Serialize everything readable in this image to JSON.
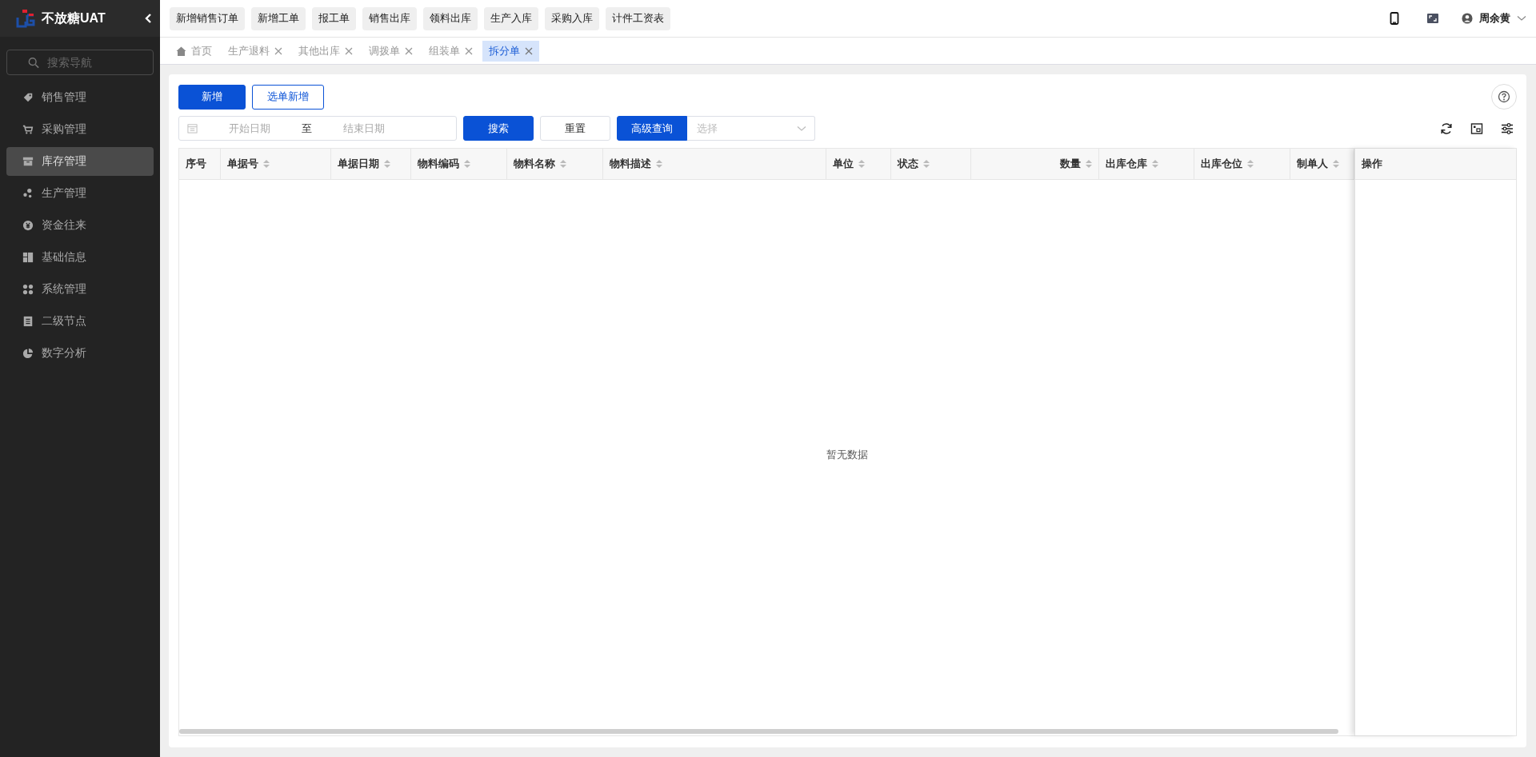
{
  "sidebar": {
    "brand": "不放糖UAT",
    "search": {
      "placeholder": "搜索导航"
    },
    "items": [
      {
        "label": "销售管理",
        "selected": false
      },
      {
        "label": "采购管理",
        "selected": false
      },
      {
        "label": "库存管理",
        "selected": true
      },
      {
        "label": "生产管理",
        "selected": false
      },
      {
        "label": "资金往来",
        "selected": false
      },
      {
        "label": "基础信息",
        "selected": false
      },
      {
        "label": "系统管理",
        "selected": false
      },
      {
        "label": "二级节点",
        "selected": false
      },
      {
        "label": "数字分析",
        "selected": false
      }
    ]
  },
  "shortcuts": [
    "新增销售订单",
    "新增工单",
    "报工单",
    "销售出库",
    "领料出库",
    "生产入库",
    "采购入库",
    "计件工资表"
  ],
  "user": {
    "name": "周余黄"
  },
  "tabs": [
    {
      "label": "首页",
      "kind": "home",
      "selected": false
    },
    {
      "label": "生产退料",
      "kind": "closable",
      "selected": false
    },
    {
      "label": "其他出库",
      "kind": "closable",
      "selected": false
    },
    {
      "label": "调拨单",
      "kind": "closable",
      "selected": false
    },
    {
      "label": "组装单",
      "kind": "closable",
      "selected": false
    },
    {
      "label": "拆分单",
      "kind": "closable",
      "selected": true
    }
  ],
  "actions": [
    {
      "label": "新增",
      "kind": "primary"
    },
    {
      "label": "选单新增",
      "kind": "outline"
    }
  ],
  "filters": {
    "date_range": {
      "start_placeholder": "开始日期",
      "separator": "至",
      "end_placeholder": "结束日期"
    },
    "search_button": "搜索",
    "reset_button": "重置",
    "advanced_button": "高级查询",
    "select": {
      "placeholder": "选择"
    }
  },
  "table": {
    "columns": [
      {
        "label": "序号",
        "sortable": false,
        "numeric": false
      },
      {
        "label": "单据号",
        "sortable": true,
        "numeric": false
      },
      {
        "label": "单据日期",
        "sortable": true,
        "numeric": false
      },
      {
        "label": "物料编码",
        "sortable": true,
        "numeric": false
      },
      {
        "label": "物料名称",
        "sortable": true,
        "numeric": false
      },
      {
        "label": "物料描述",
        "sortable": true,
        "numeric": false
      },
      {
        "label": "单位",
        "sortable": true,
        "numeric": false
      },
      {
        "label": "状态",
        "sortable": true,
        "numeric": false
      },
      {
        "label": "数量",
        "sortable": true,
        "numeric": true
      },
      {
        "label": "出库仓库",
        "sortable": true,
        "numeric": false
      },
      {
        "label": "出库仓位",
        "sortable": true,
        "numeric": false
      },
      {
        "label": "制单人",
        "sortable": true,
        "numeric": false
      }
    ],
    "fixed_column": "操作",
    "empty_text": "暂无数据"
  }
}
